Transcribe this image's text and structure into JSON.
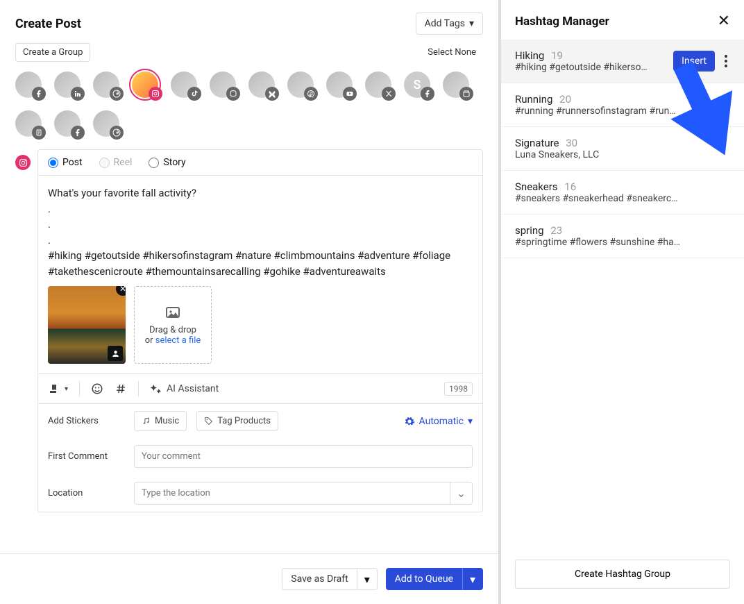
{
  "header": {
    "title": "Create Post",
    "add_tags": "Add Tags",
    "create_group": "Create a Group",
    "select_none": "Select None"
  },
  "accounts": [
    {
      "net": "facebook"
    },
    {
      "net": "linkedin"
    },
    {
      "net": "threads"
    },
    {
      "net": "instagram",
      "selected": true
    },
    {
      "net": "tiktok"
    },
    {
      "net": "mastodon"
    },
    {
      "net": "bluesky"
    },
    {
      "net": "pinterest"
    },
    {
      "net": "youtube"
    },
    {
      "net": "x"
    },
    {
      "net": "facebook",
      "letter": "S"
    },
    {
      "net": "gmb"
    },
    {
      "net": "page"
    },
    {
      "net": "facebook"
    },
    {
      "net": "threads"
    }
  ],
  "post_type": {
    "post": "Post",
    "reel": "Reel",
    "story": "Story",
    "selected": "post"
  },
  "compose": {
    "text": "What's your favorite fall activity?\n.\n.\n.\n#hiking #getoutside #hikersofinstagram #nature #climbmountains #adventure #foliage #takethescenicroute #themountainsarecalling #gohike #adventureawaits"
  },
  "media": {
    "drop_line1": "Drag & drop",
    "drop_or": "or ",
    "drop_link": "select a file"
  },
  "toolbar": {
    "ai": "AI Assistant",
    "count": "1998"
  },
  "fields": {
    "stickers_label": "Add Stickers",
    "music": "Music",
    "tag_products": "Tag Products",
    "automatic": "Automatic",
    "first_comment_label": "First Comment",
    "first_comment_ph": "Your comment",
    "location_label": "Location",
    "location_ph": "Type the location"
  },
  "footer": {
    "draft": "Save as Draft",
    "queue": "Add to Queue"
  },
  "hashtag_manager": {
    "title": "Hashtag Manager",
    "insert": "Insert",
    "create": "Create Hashtag Group",
    "items": [
      {
        "name": "Hiking",
        "count": "19",
        "tags": "#hiking #getoutside #hikerso…",
        "active": true
      },
      {
        "name": "Running",
        "count": "20",
        "tags": "#running #runnersofinstagram #run…"
      },
      {
        "name": "Signature",
        "count": "30",
        "tags": "Luna Sneakers, LLC"
      },
      {
        "name": "Sneakers",
        "count": "16",
        "tags": "#sneakers #sneakerhead #sneakerc…"
      },
      {
        "name": "spring",
        "count": "23",
        "tags": "#springtime #flowers #sunshine #ha…"
      }
    ]
  }
}
